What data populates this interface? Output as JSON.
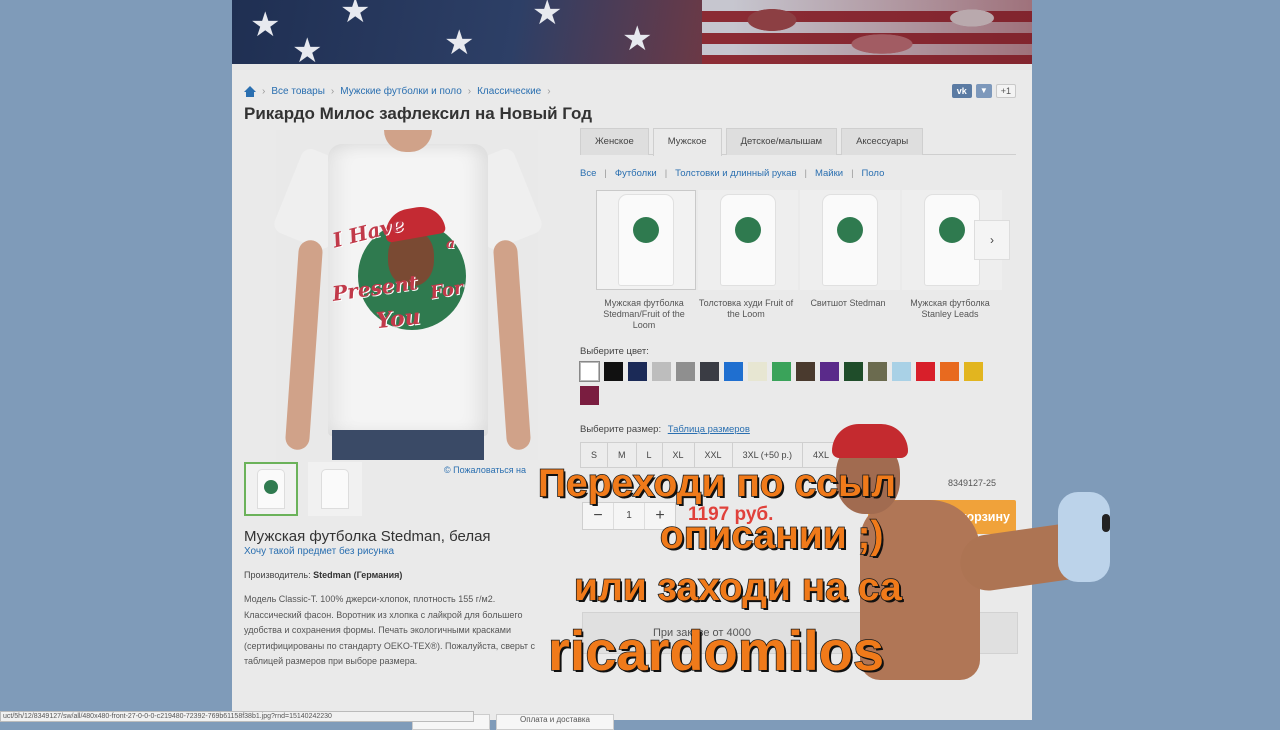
{
  "breadcrumb": [
    "Все товары",
    "Мужские футболки и поло",
    "Классические"
  ],
  "social": {
    "vk": "vk",
    "vk_drop": "▼",
    "plus": "+1"
  },
  "title": "Рикардо Милос зафлексил на Новый Год",
  "print_text": {
    "line1": "I Have",
    "line2": "a",
    "line3": "Present",
    "line4": "For",
    "line5": "You"
  },
  "complain_link": "© Пожаловаться на",
  "product": {
    "name": "Мужская футболка Stedman, белая",
    "no_print_link": "Хочу такой предмет без рисунка",
    "maker_label": "Производитель:",
    "maker_value": "Stedman (Германия)",
    "description": "Модель Classic-T. 100% джерси-хлопок, плотность 155 г/м2. Классический фасон. Воротник из хлопка с лайкрой для большего удобства и сохранения формы. Печать экологичными красками (сертифицированы по стандарту OEKO-TEX®). Пожалуйста, сверьт с таблицей размеров при выборе размера."
  },
  "tabs": [
    "Женское",
    "Мужское",
    "Детское/малышам",
    "Аксессуары"
  ],
  "subnav": [
    "Все",
    "Футболки",
    "Толстовки и длинный рукав",
    "Майки",
    "Поло"
  ],
  "products": [
    {
      "label": "Мужская футболка Stedman/Fruit of the Loom"
    },
    {
      "label": "Толстовка худи Fruit of the Loom"
    },
    {
      "label": "Свитшот Stedman"
    },
    {
      "label": "Мужская футболка Stanley Leads"
    }
  ],
  "next_arrow": "›",
  "color_label": "Выберите цвет:",
  "colors": [
    "#ffffff",
    "#111111",
    "#1b2a57",
    "#bdbdbd",
    "#8f8f8f",
    "#3a3c44",
    "#1f6fd0",
    "#e7e6d2",
    "#3aa35a",
    "#4a3a2e",
    "#5a2a8a",
    "#1f4d2a",
    "#6b6b4f",
    "#a9d1e6",
    "#d81f2a",
    "#e86a1f",
    "#e2b51f",
    "#7a1d40"
  ],
  "size_label": "Выберите размер:",
  "size_table_link": "Таблица размеров",
  "sizes": [
    "S",
    "M",
    "L",
    "XL",
    "XXL",
    "3XL (+50 р.)",
    "4XL"
  ],
  "article": "8349127-25",
  "quantity": {
    "minus": "−",
    "value": "1",
    "plus": "+"
  },
  "price": "1197 руб.",
  "cart_button": "авить в корзину",
  "promo_text": "При заказе от 4000",
  "bottom_button": "Оплата и доставка",
  "status_url": "uct/5h/12/8349127/sw/all/480x480-front-27-0-0-0-c219480-72392-769b61158f38b1.jpg?rnd=15140242230",
  "caption": {
    "line1": "Переходи по ссыл",
    "line2": "описании ;)",
    "line3": "или заходи на са",
    "line4": "ricardomilos"
  }
}
